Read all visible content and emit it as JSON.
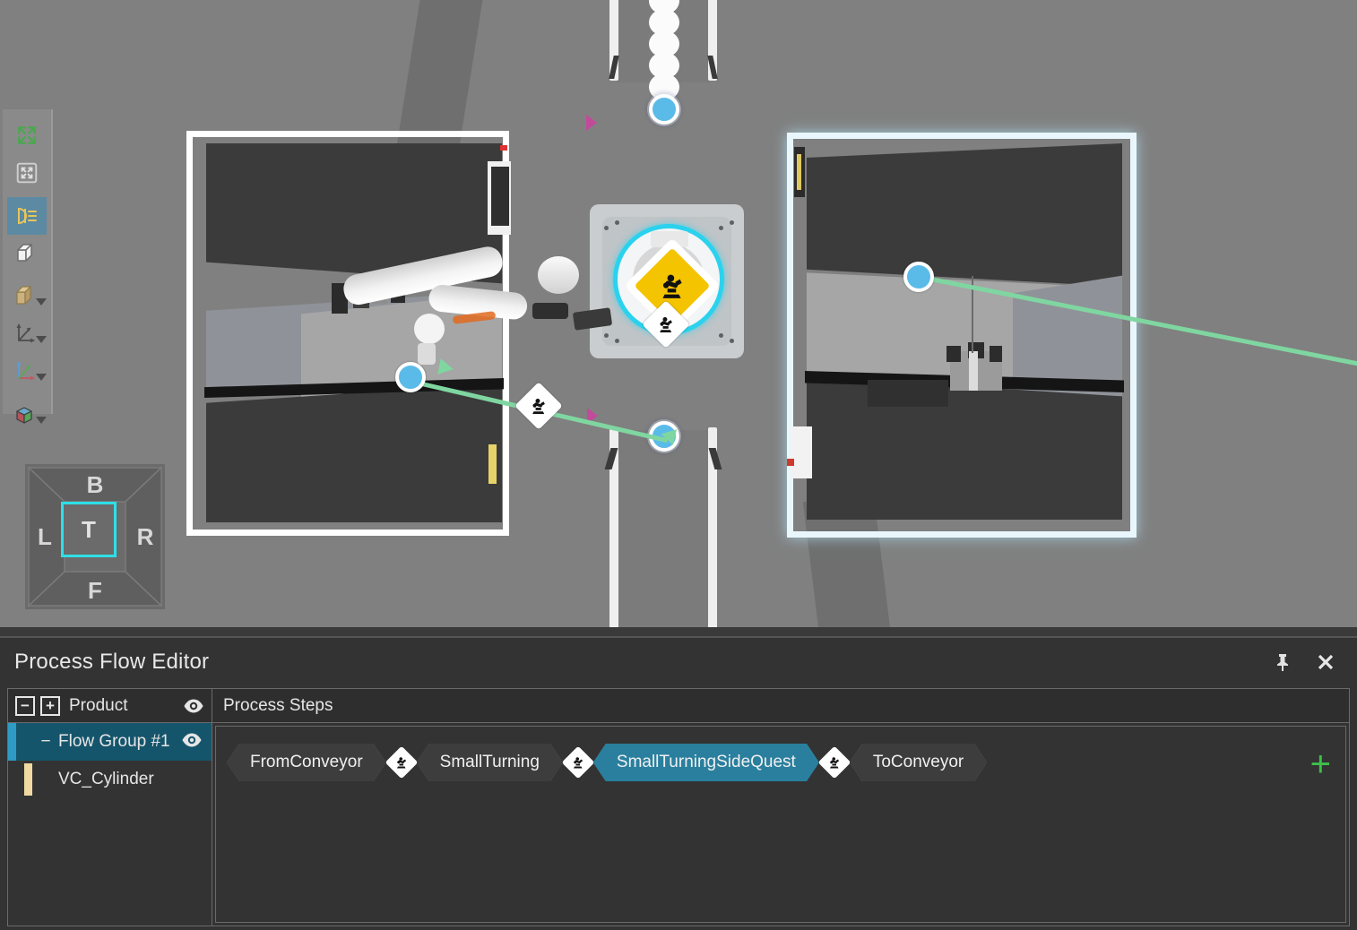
{
  "viewport": {
    "name": "3d-viewport",
    "background_color": "#808080",
    "floor_color": "#3a3a3a",
    "highlight_color": "#2ad2ee",
    "flow_color": "#7fd6a0",
    "node_color": "#5bbbe8"
  },
  "toolbar": {
    "items": [
      {
        "icon": "fit-to-view-icon",
        "label": "Fit to view",
        "active": false
      },
      {
        "icon": "zoom-to-selection-icon",
        "label": "Zoom to selection",
        "active": false
      },
      {
        "icon": "headlight-icon",
        "label": "Headlight",
        "active": true
      },
      {
        "icon": "wireframe-cube-icon",
        "label": "Wireframe",
        "active": false
      },
      {
        "icon": "solid-cube-icon",
        "label": "Rendering style",
        "active": false,
        "has_dropdown": true
      },
      {
        "icon": "axes-gray-icon",
        "label": "Coordinate display",
        "active": false,
        "has_dropdown": true
      },
      {
        "icon": "axes-color-icon",
        "label": "Frames",
        "active": false,
        "has_dropdown": true
      },
      {
        "icon": "rgb-cube-icon",
        "label": "Component display",
        "active": false,
        "has_dropdown": true
      }
    ]
  },
  "viewcube": {
    "name": "view-cube",
    "back": "B",
    "left": "L",
    "top": "T",
    "right": "R",
    "front": "F",
    "selected": "T",
    "selected_color": "#2fdfe8"
  },
  "panel": {
    "title": "Process Flow Editor",
    "pin_label": "Pin",
    "close_label": "Close"
  },
  "tree": {
    "header_label": "Product",
    "collapse_all_label": "−",
    "expand_all_label": "+",
    "visibility_label": "Toggle visibility",
    "rows": [
      {
        "label": "Flow Group #1",
        "expander": "−",
        "selected": true,
        "has_eye": true,
        "bar_color": "#2e9bc4",
        "indent": 0
      },
      {
        "label": "VC_Cylinder",
        "expander": "",
        "selected": false,
        "has_eye": false,
        "bar_color": "#f0daa2",
        "indent": 1
      }
    ]
  },
  "steps": {
    "header_label": "Process Steps",
    "add_label": "+",
    "items": [
      {
        "label": "FromConveyor",
        "selected": false
      },
      {
        "label": "SmallTurning",
        "selected": false
      },
      {
        "label": "SmallTurningSideQuest",
        "selected": true
      },
      {
        "label": "ToConveyor",
        "selected": false
      }
    ],
    "connector_icon": "robot-statement-icon",
    "selected_fill": "#2a7f9e",
    "selected_border": "#45d2f0",
    "add_color": "#3fbf4a"
  }
}
